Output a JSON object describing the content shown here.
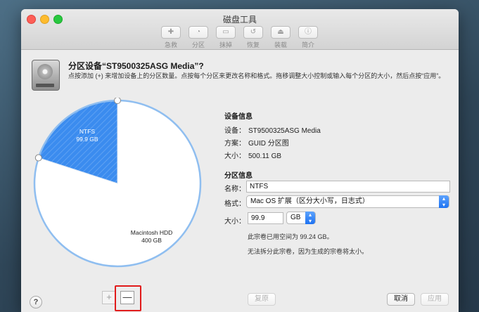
{
  "window": {
    "title": "磁盘工具",
    "toolbar": [
      {
        "label": "急救",
        "icon": "stethoscope-icon",
        "glyph": "✚"
      },
      {
        "label": "分区",
        "icon": "partition-icon",
        "glyph": "◔"
      },
      {
        "label": "抹掉",
        "icon": "erase-icon",
        "glyph": "▭"
      },
      {
        "label": "恢复",
        "icon": "restore-icon",
        "glyph": "↺"
      },
      {
        "label": "装载",
        "icon": "mount-icon",
        "glyph": "⏏"
      },
      {
        "label": "简介",
        "icon": "info-icon",
        "glyph": "ⓘ"
      }
    ]
  },
  "sheet": {
    "title": "分区设备“ST9500325ASG Media”?",
    "description": "点按添加 (+) 来增加设备上的分区数量。点按每个分区来更改名称和格式。拖移调整大小控制或输入每个分区的大小，然后点按“应用”。"
  },
  "pie": {
    "partitions": [
      {
        "name": "NTFS",
        "size": "99.9 GB",
        "fraction": 0.2
      },
      {
        "name": "Macintosh HDD",
        "size": "400 GB",
        "fraction": 0.8
      }
    ],
    "colors": {
      "selected": "#3b8cef",
      "unselected": "#ffffff",
      "outline": "#8fbef0"
    }
  },
  "device_info": {
    "heading": "设备信息",
    "rows": [
      {
        "key": "设备：",
        "value": "ST9500325ASG Media"
      },
      {
        "key": "方案：",
        "value": "GUID 分区图"
      },
      {
        "key": "大小：",
        "value": "500.11 GB"
      }
    ]
  },
  "partition_info": {
    "heading": "分区信息",
    "name_label": "名称：",
    "name_value": "NTFS",
    "format_label": "格式：",
    "format_value": "Mac OS 扩展（区分大小写，日志式）",
    "size_label": "大小：",
    "size_value": "99.9",
    "unit_value": "GB",
    "note1": "此宗卷已用空间为 99.24 GB。",
    "note2": "无法拆分此宗卷，因为生成的宗卷将太小。"
  },
  "buttons": {
    "help": "?",
    "add": "+",
    "remove": "—",
    "revert": "复原",
    "cancel": "取消",
    "apply": "应用"
  },
  "colors": {
    "accent": "#1d72f2",
    "highlight_box": "#e11b1b"
  }
}
